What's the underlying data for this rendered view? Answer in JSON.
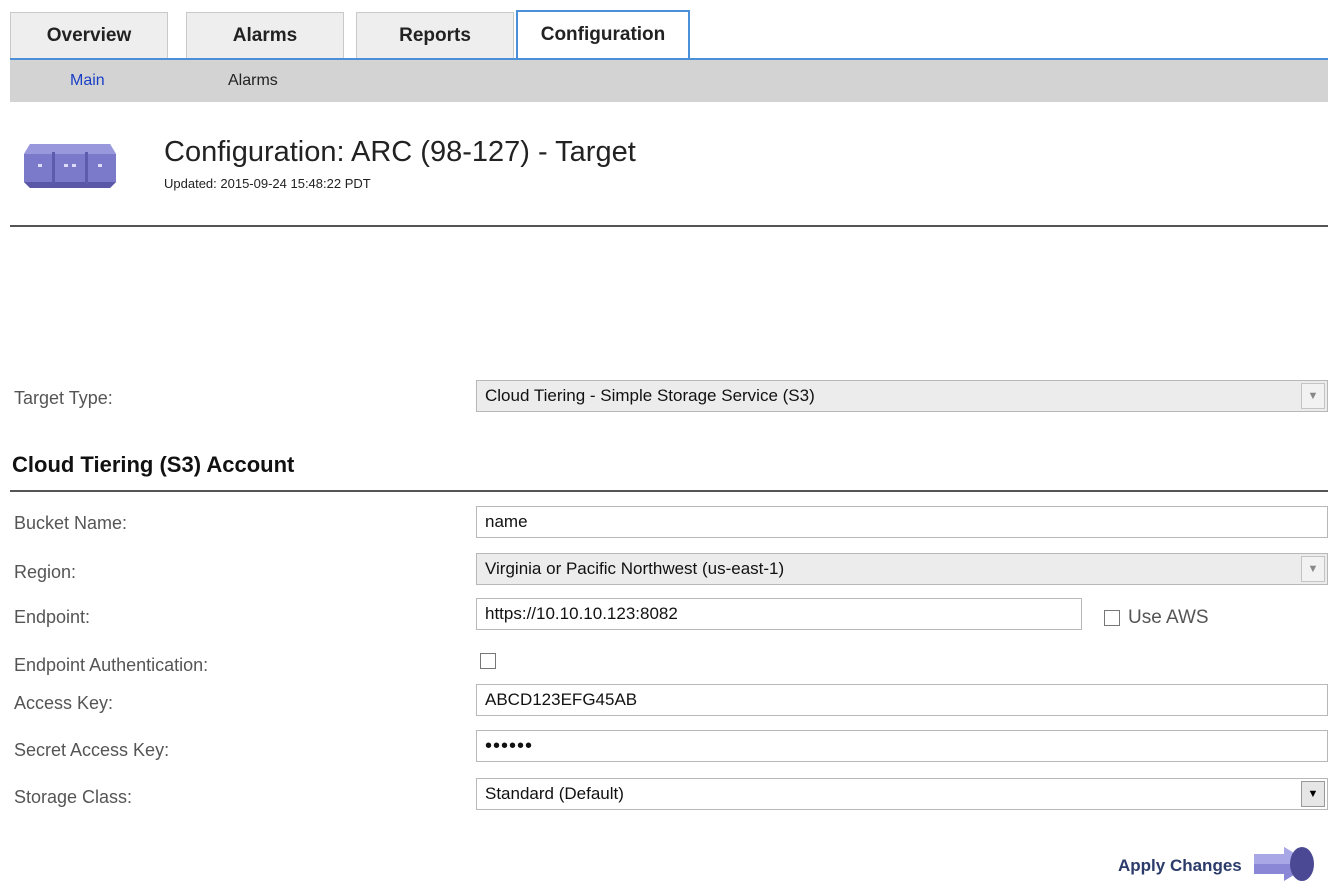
{
  "tabs": [
    {
      "label": "Overview",
      "active": false
    },
    {
      "label": "Alarms",
      "active": false
    },
    {
      "label": "Reports",
      "active": false
    },
    {
      "label": "Configuration",
      "active": true
    }
  ],
  "subtabs": [
    {
      "label": "Main",
      "active": true
    },
    {
      "label": "Alarms",
      "active": false
    }
  ],
  "header": {
    "icon": "storage-archive-icon",
    "title": "Configuration: ARC (98-127) - Target",
    "updated": "Updated: 2015-09-24 15:48:22 PDT"
  },
  "form": {
    "target_type_label": "Target Type:",
    "target_type_value": "Cloud Tiering - Simple Storage Service (S3)",
    "section_title": "Cloud Tiering (S3) Account",
    "bucket_label": "Bucket Name:",
    "bucket_value": "name",
    "region_label": "Region:",
    "region_value": "Virginia or Pacific Northwest (us-east-1)",
    "endpoint_label": "Endpoint:",
    "endpoint_value": "https://10.10.10.123:8082",
    "use_aws_label": "Use AWS",
    "use_aws_checked": false,
    "endpoint_auth_label": "Endpoint Authentication:",
    "endpoint_auth_checked": false,
    "access_key_label": "Access Key:",
    "access_key_value": "ABCD123EFG45AB",
    "secret_key_label": "Secret Access Key:",
    "secret_key_value": "••••••",
    "storage_class_label": "Storage Class:",
    "storage_class_value": "Standard (Default)"
  },
  "actions": {
    "apply_label": "Apply Changes",
    "apply_icon": "arrow-right-icon"
  },
  "colors": {
    "active_tab_border": "#4a90d9",
    "subnav_bg": "#d3d3d3",
    "active_link": "#1a3fc7",
    "icon_purple": "#7b79c9"
  }
}
